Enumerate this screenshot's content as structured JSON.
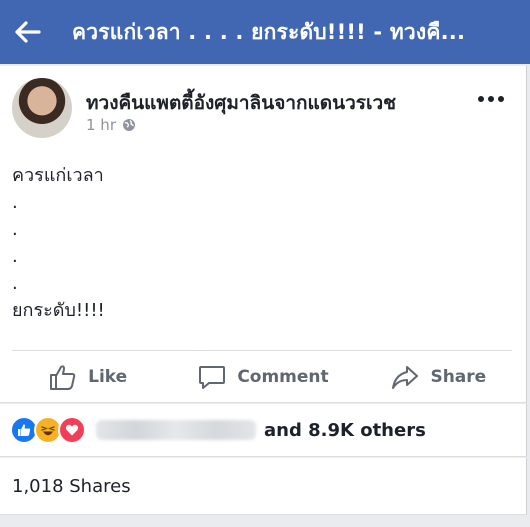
{
  "topbar": {
    "title": "ควรแก่เวลา . . . . ยกระดับ!!!! - ทวงคื...",
    "back_icon": "arrow-left-icon",
    "bg_color": "#4267b2"
  },
  "post": {
    "author": "ทวงคืนแพตตี้อังศุมาลินจากแดนวรเวช",
    "time": "1 hr",
    "privacy_icon": "globe-icon",
    "text": "ควรแก่เวลา\n.\n.\n.\n.\nยกระดับ!!!!"
  },
  "actions": {
    "like_label": "Like",
    "comment_label": "Comment",
    "share_label": "Share"
  },
  "reactions": {
    "icons": [
      "like-reaction-icon",
      "haha-reaction-icon",
      "love-reaction-icon"
    ],
    "others_text": "and 8.9K others"
  },
  "shares": {
    "text": "1,018 Shares"
  }
}
